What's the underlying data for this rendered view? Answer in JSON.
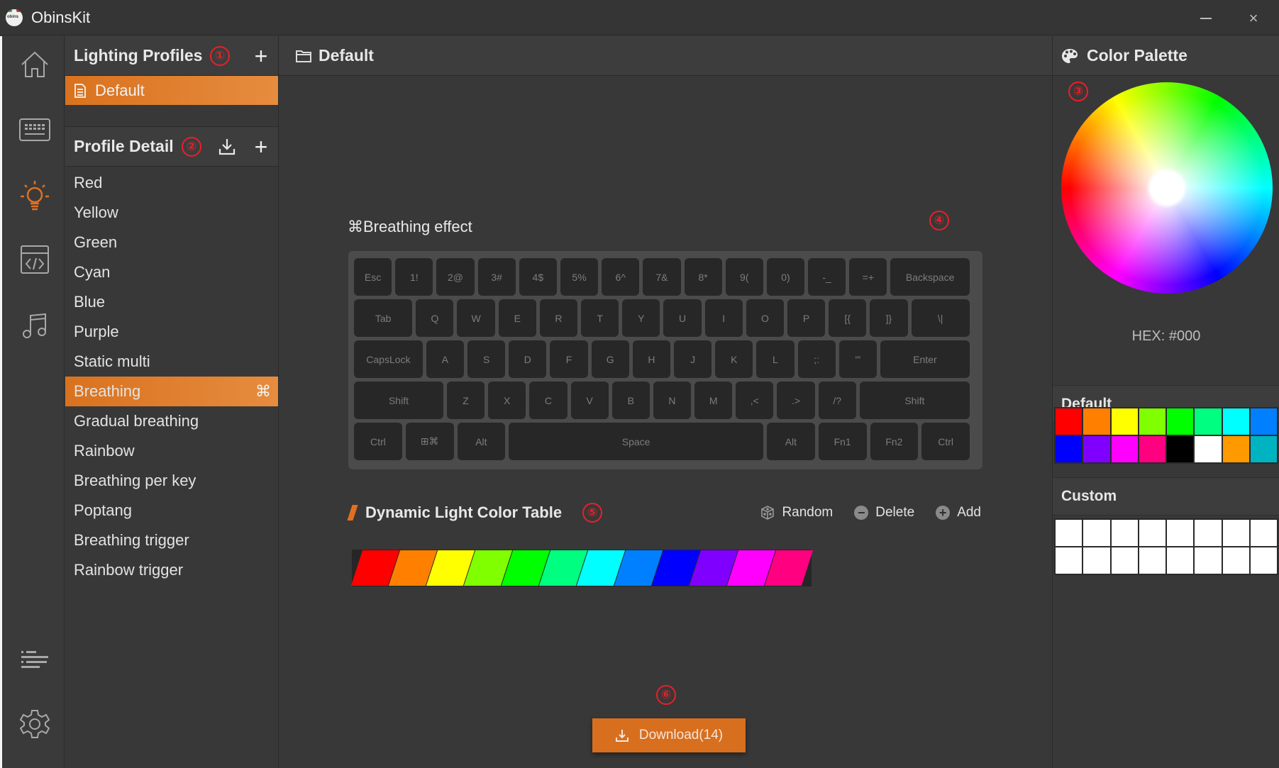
{
  "app": {
    "title": "ObinsKit",
    "logo_text": "obins"
  },
  "window_controls": {
    "minimize": "minimize",
    "close": "×"
  },
  "rail": {
    "items": [
      {
        "name": "home",
        "active": false
      },
      {
        "name": "keyboard",
        "active": false
      },
      {
        "name": "lighting",
        "active": true
      },
      {
        "name": "macro",
        "active": false
      },
      {
        "name": "music",
        "active": false
      },
      {
        "name": "log",
        "active": false
      },
      {
        "name": "settings",
        "active": false
      }
    ],
    "accent_color": "#e07020"
  },
  "lighting_profiles": {
    "title": "Lighting Profiles",
    "marker": "①",
    "add_label": "+",
    "items": [
      {
        "label": "Default",
        "active": true
      }
    ]
  },
  "profile_detail": {
    "title": "Profile Detail",
    "marker": "②",
    "add_label": "+",
    "active_marker": "⌘",
    "items": [
      {
        "label": "Red"
      },
      {
        "label": "Yellow"
      },
      {
        "label": "Green"
      },
      {
        "label": "Cyan"
      },
      {
        "label": "Blue"
      },
      {
        "label": "Purple"
      },
      {
        "label": "Static multi"
      },
      {
        "label": "Breathing",
        "active": true
      },
      {
        "label": "Gradual breathing"
      },
      {
        "label": "Rainbow"
      },
      {
        "label": "Breathing per key"
      },
      {
        "label": "Poptang"
      },
      {
        "label": "Breathing trigger"
      },
      {
        "label": "Rainbow trigger"
      }
    ]
  },
  "main": {
    "header_title": "Default",
    "effect_title": "⌘Breathing effect",
    "effect_marker": "④",
    "keyboard": {
      "rows": [
        [
          {
            "k": "Esc",
            "w": 1
          },
          {
            "k": "1!",
            "w": 1
          },
          {
            "k": "2@",
            "w": 1
          },
          {
            "k": "3#",
            "w": 1
          },
          {
            "k": "4$",
            "w": 1
          },
          {
            "k": "5%",
            "w": 1
          },
          {
            "k": "6^",
            "w": 1
          },
          {
            "k": "7&",
            "w": 1
          },
          {
            "k": "8*",
            "w": 1
          },
          {
            "k": "9(",
            "w": 1
          },
          {
            "k": "0)",
            "w": 1
          },
          {
            "k": "-_",
            "w": 1
          },
          {
            "k": "=+",
            "w": 1
          },
          {
            "k": "Backspace",
            "w": 2
          }
        ],
        [
          {
            "k": "Tab",
            "w": 1.5
          },
          {
            "k": "Q",
            "w": 1
          },
          {
            "k": "W",
            "w": 1
          },
          {
            "k": "E",
            "w": 1
          },
          {
            "k": "R",
            "w": 1
          },
          {
            "k": "T",
            "w": 1
          },
          {
            "k": "Y",
            "w": 1
          },
          {
            "k": "U",
            "w": 1
          },
          {
            "k": "I",
            "w": 1
          },
          {
            "k": "O",
            "w": 1
          },
          {
            "k": "P",
            "w": 1
          },
          {
            "k": "[{",
            "w": 1
          },
          {
            "k": "]}",
            "w": 1
          },
          {
            "k": "\\|",
            "w": 1.5
          }
        ],
        [
          {
            "k": "CapsLock",
            "w": 1.75
          },
          {
            "k": "A",
            "w": 1
          },
          {
            "k": "S",
            "w": 1
          },
          {
            "k": "D",
            "w": 1
          },
          {
            "k": "F",
            "w": 1
          },
          {
            "k": "G",
            "w": 1
          },
          {
            "k": "H",
            "w": 1
          },
          {
            "k": "J",
            "w": 1
          },
          {
            "k": "K",
            "w": 1
          },
          {
            "k": "L",
            "w": 1
          },
          {
            "k": ";:",
            "w": 1
          },
          {
            "k": "'\"",
            "w": 1
          },
          {
            "k": "Enter",
            "w": 2.25
          }
        ],
        [
          {
            "k": "Shift",
            "w": 2.25
          },
          {
            "k": "Z",
            "w": 1
          },
          {
            "k": "X",
            "w": 1
          },
          {
            "k": "C",
            "w": 1
          },
          {
            "k": "V",
            "w": 1
          },
          {
            "k": "B",
            "w": 1
          },
          {
            "k": "N",
            "w": 1
          },
          {
            "k": "M",
            "w": 1
          },
          {
            "k": ",<",
            "w": 1
          },
          {
            "k": ".>",
            "w": 1
          },
          {
            "k": "/?",
            "w": 1
          },
          {
            "k": "Shift",
            "w": 2.75
          }
        ],
        [
          {
            "k": "Ctrl",
            "w": 1.25
          },
          {
            "k": "⊞⌘",
            "w": 1.25
          },
          {
            "k": "Alt",
            "w": 1.25
          },
          {
            "k": "Space",
            "w": 6.25
          },
          {
            "k": "Alt",
            "w": 1.25
          },
          {
            "k": "Fn1",
            "w": 1.25
          },
          {
            "k": "Fn2",
            "w": 1.25
          },
          {
            "k": "Ctrl",
            "w": 1.25
          }
        ]
      ]
    },
    "color_table": {
      "title": "Dynamic Light Color Table",
      "marker": "⑤",
      "random_label": "Random",
      "delete_label": "Delete",
      "add_label": "Add",
      "colors": [
        "#ff0000",
        "#ff8000",
        "#ffff00",
        "#80ff00",
        "#00ff00",
        "#00ff80",
        "#00ffff",
        "#0080ff",
        "#0000ff",
        "#8000ff",
        "#ff00ff",
        "#ff0080"
      ]
    },
    "download_marker": "⑥",
    "download_label": "Download(14)"
  },
  "palette": {
    "title": "Color Palette",
    "marker": "③",
    "hex_label": "HEX: #000",
    "default_title": "Default",
    "default_colors": [
      "#ff0000",
      "#ff8000",
      "#ffff00",
      "#80ff00",
      "#00ff00",
      "#00ff80",
      "#00ffff",
      "#0080ff",
      "#0000ff",
      "#8000ff",
      "#ff00ff",
      "#ff0080",
      "#000000",
      "#ffffff",
      "#ff9900",
      "#00b3c0"
    ],
    "custom_title": "Custom",
    "custom_colors": [
      "#ffffff",
      "#ffffff",
      "#ffffff",
      "#ffffff",
      "#ffffff",
      "#ffffff",
      "#ffffff",
      "#ffffff",
      "#ffffff",
      "#ffffff",
      "#ffffff",
      "#ffffff",
      "#ffffff",
      "#ffffff",
      "#ffffff",
      "#ffffff"
    ]
  }
}
